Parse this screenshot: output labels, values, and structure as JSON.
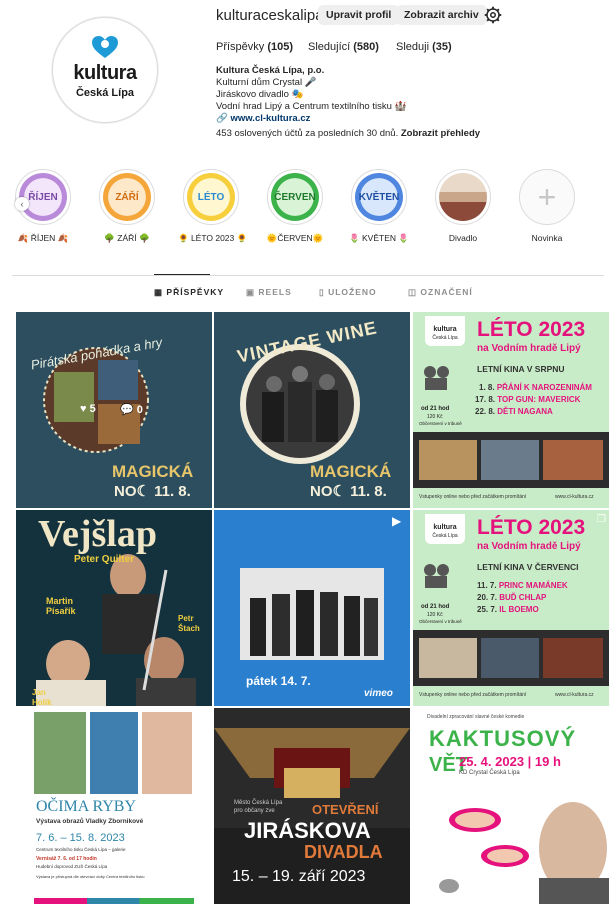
{
  "profile": {
    "username": "kulturaceskalipa",
    "edit_button": "Upravit profil",
    "archive_button": "Zobrazit archiv",
    "logo_line1": "kultura",
    "logo_line2": "Česká Lípa",
    "stats": {
      "posts_label": "Příspěvky",
      "posts_count": "(105)",
      "followers_label": "Sledující",
      "followers_count": "(580)",
      "following_label": "Sleduji",
      "following_count": "(35)"
    },
    "bio": {
      "name": "Kultura Česká Lípa, p.o.",
      "line1": "Kulturní dům Crystal 🎤",
      "line2": "Jiráskovo divadlo 🎭",
      "line3": "Vodní hrad Lipý a Centrum textilního tisku 🏰",
      "link": "www.cl-kultura.cz"
    },
    "reach_text": "453 oslovených účtů za posledních 30 dnů.",
    "reach_link": "Zobrazit přehledy"
  },
  "highlights": [
    {
      "title": "ŘÍJEN",
      "label": "🍂 ŘÍJEN 🍂",
      "color": "#b98ad9"
    },
    {
      "title": "ZÁŘÍ",
      "label": "🌳 ZÁŘÍ 🌳",
      "color": "#f5a63a"
    },
    {
      "title": "LÉTO",
      "label": "🌻 LÉTO 2023 🌻",
      "color": "#f7cf3d"
    },
    {
      "title": "ČERVEN",
      "label": "🌞ČERVEN🌞",
      "color": "#3cb34a"
    },
    {
      "title": "KVĚTEN",
      "label": "🌷 KVĚTEN 🌷",
      "color": "#4f86e0"
    },
    {
      "title": "",
      "label": "Divadlo",
      "color": "#c9a58a"
    },
    {
      "title": "+",
      "label": "Novinka",
      "color": "#ffffff"
    }
  ],
  "tabs": [
    {
      "label": "PŘÍSPĚVKY",
      "icon": "grid-icon"
    },
    {
      "label": "REELS",
      "icon": "reels-icon"
    },
    {
      "label": "ULOŽENO",
      "icon": "bookmark-icon"
    },
    {
      "label": "OZNAČENÍ",
      "icon": "tag-icon"
    }
  ],
  "posts": {
    "p1": {
      "title": "Pirátská pohádka a hry",
      "likes": "5",
      "comments": "0",
      "brand": "MAGICKÁ",
      "date": "NO☾ 11. 8."
    },
    "p2": {
      "title": "VINTAGE WINE",
      "brand": "MAGICKÁ",
      "date": "NO☾ 11. 8."
    },
    "p3": {
      "logo": "kultura",
      "logo_sub": "Česká Lípa",
      "title": "LÉTO 2023",
      "subtitle": "na Vodním hradě Lipý",
      "cinema": "LETNÍ KINA V SRPNU",
      "films": [
        {
          "date": "1. 8.",
          "name": "PŘÁNÍ K NAROZENINÁM"
        },
        {
          "date": "17. 8.",
          "name": "TOP GUN: MAVERICK"
        },
        {
          "date": "22. 8.",
          "name": "DĚTI NAGANA"
        }
      ],
      "time": "od 21 hod",
      "price": "120 Kč",
      "venue": "Občerstvení v tribuně",
      "footer": "Vstupenky online nebo před začátkem promítání",
      "web": "www.cl-kultura.cz"
    },
    "p4": {
      "title": "Vejšlap",
      "subtitle": "Peter Quilter",
      "actor1a": "Martin",
      "actor1b": "Písařík",
      "actor2a": "Petr",
      "actor2b": "Štach",
      "actor3a": "Jan",
      "actor3b": "Holík"
    },
    "p5": {
      "date": "pátek 14. 7.",
      "brand": "vimeo"
    },
    "p6": {
      "logo": "kultura",
      "logo_sub": "Česká Lípa",
      "title": "LÉTO 2023",
      "subtitle": "na Vodním hradě Lipý",
      "cinema": "LETNÍ KINA V ČERVENCI",
      "films": [
        {
          "date": "11. 7.",
          "name": "PRINC MAMÁNEK"
        },
        {
          "date": "20. 7.",
          "name": "BUĎ CHLAP"
        },
        {
          "date": "25. 7.",
          "name": "IL BOEMO"
        }
      ],
      "time": "od 21 hod",
      "price": "120 Kč",
      "venue": "Občerstvení v tribuně",
      "footer": "Vstupenky online nebo před začátkem promítání",
      "web": "www.cl-kultura.cz"
    },
    "p7": {
      "title": "OČIMA RYBY",
      "subtitle": "Výstava obrazů Vladky Zbornikové",
      "dates": "7. 6. – 15. 8. 2023",
      "place": "Centrum textilního tisku Česká Lípa – galerie",
      "opening": "Vernisáž 7. 6. od 17 hodin",
      "music": "Hudební doprovod ZUŠ Česká Lípa",
      "note": "Výstava je přístupná dle otevírací doby Centra textilního tisku"
    },
    "p8": {
      "org1": "Město Česká Lípa",
      "org2": "pro občany zve",
      "title1": "OTEVŘENÍ",
      "title2": "JIRÁSKOVA",
      "title3": "DIVADLA",
      "dates": "15. – 19. září 2023"
    },
    "p9": {
      "intro": "Divadelní zpracování slavné české komedie",
      "title": "KAKTUSOVÝ",
      "title_side": "VĚT",
      "date": "25. 4. 2023 | 19 h",
      "venue": "KD Crystal Česká Lípa"
    }
  },
  "colors": {
    "accent": "#0095f6",
    "border": "#dbdbdb",
    "muted": "#8e8e8e"
  }
}
